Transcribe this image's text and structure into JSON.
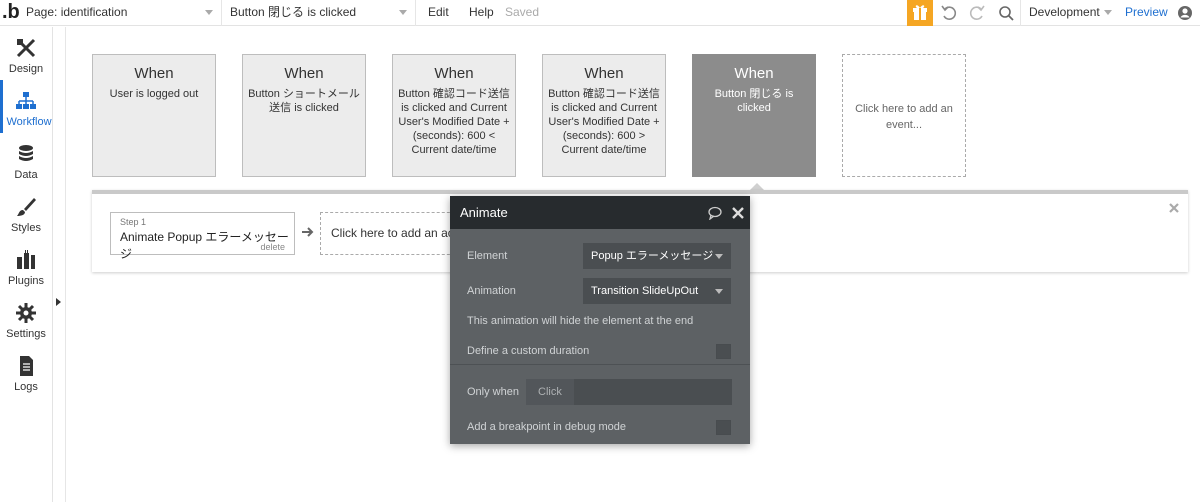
{
  "topbar": {
    "logo": ".b",
    "page_selector": "Page: identification",
    "event_selector": "Button 閉じる is clicked",
    "edit_label": "Edit",
    "help_label": "Help",
    "saved_label": "Saved",
    "gift_icon": "gift-icon",
    "undo_icon": "undo-icon",
    "redo_icon": "redo-icon",
    "search_icon": "search-icon",
    "environment": "Development",
    "preview_label": "Preview",
    "account_icon": "account-icon",
    "gift_color": "#f5a623",
    "link_color": "#1e6fd0"
  },
  "sidebar": {
    "items": [
      {
        "label": "Design",
        "icon": "design-icon"
      },
      {
        "label": "Workflow",
        "icon": "workflow-icon"
      },
      {
        "label": "Data",
        "icon": "database-icon"
      },
      {
        "label": "Styles",
        "icon": "brush-icon"
      },
      {
        "label": "Plugins",
        "icon": "plugins-icon"
      },
      {
        "label": "Settings",
        "icon": "gear-icon"
      },
      {
        "label": "Logs",
        "icon": "document-icon"
      }
    ],
    "active": "Workflow"
  },
  "events": [
    {
      "when": "When",
      "desc": "User is logged out"
    },
    {
      "when": "When",
      "desc": "Button ショートメール送信 is clicked"
    },
    {
      "when": "When",
      "desc": "Button 確認コード送信 is clicked and Current User's Modified Date +(seconds): 600 < Current date/time"
    },
    {
      "when": "When",
      "desc": "Button 確認コード送信 is clicked and Current User's Modified Date +(seconds): 600 > Current date/time"
    },
    {
      "when": "When",
      "desc": "Button 閉じる is clicked",
      "selected": true
    }
  ],
  "add_event_label": "Click here to add an event...",
  "action_strip": {
    "step_number": "Step 1",
    "step_text": "Animate Popup エラーメッセージ",
    "delete_label": "delete",
    "add_action_label": "Click here to add an action..."
  },
  "panel": {
    "title": "Animate",
    "element_label": "Element",
    "element_value": "Popup エラーメッセージ",
    "animation_label": "Animation",
    "animation_value": "Transition SlideUpOut",
    "hint": "This animation will hide the element at the end",
    "custom_duration_label": "Define a custom duration",
    "only_when_label": "Only when",
    "only_when_placeholder": "Click",
    "breakpoint_label": "Add a breakpoint in debug mode",
    "header_color": "#272b2e",
    "body_color": "#5d6164"
  }
}
